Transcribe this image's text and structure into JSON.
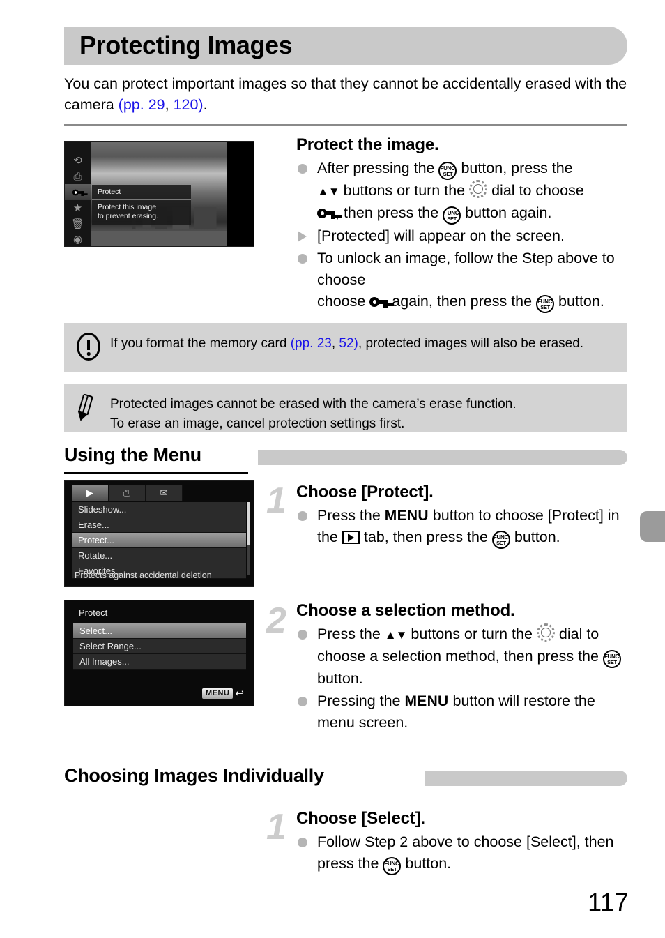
{
  "page": {
    "title": "Protecting Images",
    "number": "117"
  },
  "intro": {
    "text_before": "You can protect important images so that they cannot be accidentally erased with the camera ",
    "ref_open": "(pp. 29",
    "ref_sep": ", ",
    "ref_second": "120)",
    "text_after": "."
  },
  "lcd_protect_overlay": {
    "sidebar_icons": [
      "rotate-icon",
      "print-icon",
      "protect-key-icon",
      "favorites-star-icon",
      "erase-trash-icon",
      "playback-icon"
    ],
    "overlay_title": "Protect",
    "overlay_line1": "Protect this image",
    "overlay_line2": "to prevent erasing."
  },
  "step_protect": {
    "heading": "Protect the image.",
    "b1_p1": "After pressing the ",
    "b1_p2": " button, press the ",
    "b1_p3": " buttons or turn the ",
    "b1_p4": " dial to choose ",
    "b1_p5": ", then press the ",
    "b1_p6": " button again.",
    "b2": "[Protected] will appear on the screen.",
    "b3_p1": "To unlock an image, follow the Step above to choose ",
    "b3_p2": " again, then press the ",
    "b3_p3": " button."
  },
  "callout_important": {
    "icon": "important-exclamation-icon",
    "text_before": "If you format the memory card ",
    "ref_open": "(pp. 23",
    "ref_sep": ", ",
    "ref_second": "52)",
    "text_after": ", protected images will also be erased."
  },
  "callout_note": {
    "icon": "note-pencil-icon",
    "line1": "Protected images cannot be erased with the camera’s erase function.",
    "line2": "To erase an image, cancel protection settings first."
  },
  "section_using_menu": {
    "heading": "Using the Menu"
  },
  "lcd_menu": {
    "tabs": [
      "playback-tab-icon",
      "print-tab-icon",
      "settings-tab-icon"
    ],
    "items": [
      "Slideshow...",
      "Erase...",
      "Protect...",
      "Rotate...",
      "Favorites..."
    ],
    "selected_index": 2,
    "hint": "Protects against accidental deletion"
  },
  "step_1_choose_protect": {
    "number": "1",
    "heading": "Choose [Protect].",
    "b1_p1": "Press the ",
    "b1_menu": "MENU",
    "b1_p2": " button to choose [Protect] in the ",
    "b1_p3": " tab, then press the ",
    "b1_p4": " button."
  },
  "lcd_protect_select": {
    "title": "Protect",
    "items": [
      "Select...",
      "Select Range...",
      "All Images..."
    ],
    "selected_index": 0,
    "badge_label": "MENU",
    "badge_arrow": "↩"
  },
  "step_2_selection_method": {
    "number": "2",
    "heading": "Choose a selection method.",
    "b1_p1": "Press the ",
    "b1_p2": " buttons or turn the ",
    "b1_p3": " dial to choose a selection method, then press the ",
    "b1_p4": " button.",
    "b2_p1": "Pressing the ",
    "b2_menu": "MENU",
    "b2_p2": " button will restore the menu screen."
  },
  "section_choosing_individually": {
    "heading": "Choosing Images Individually"
  },
  "step_1_choose_select": {
    "number": "1",
    "heading": "Choose [Select].",
    "b1_p1": "Follow Step 2 above to choose [Select], then press the ",
    "b1_p2": " button."
  },
  "colors": {
    "page_reference_link": "#1a13e8",
    "banner_gray": "#c9c9c9",
    "callout_gray": "#d3d3d3",
    "bullet_gray": "#b5b5b5",
    "step_number_gray": "#cccccc",
    "rule_gray": "#8a8a8a",
    "edge_tab_gray": "#9b9b9b"
  }
}
